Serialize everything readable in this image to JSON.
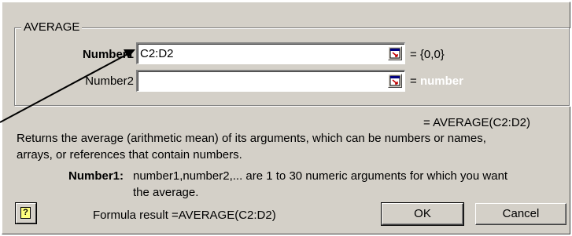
{
  "dialog": {
    "group_title": "AVERAGE",
    "args": [
      {
        "label": "Number1",
        "value": "C2:D2",
        "result": "= {0,0}"
      },
      {
        "label": "Number2",
        "value": "",
        "result_prefix": "= ",
        "result_hint": "number"
      }
    ],
    "formula_preview": "= AVERAGE(C2:D2)",
    "description_line1": "Returns the average (arithmetic mean) of its arguments, which can be numbers or names,",
    "description_line2": "arrays, or references that contain numbers.",
    "arg_help_label": "Number1:",
    "arg_help_text1": "number1,number2,... are 1 to 30 numeric arguments for which you want",
    "arg_help_text2": "the average.",
    "formula_result": "Formula result =AVERAGE(C2:D2)",
    "ok_label": "OK",
    "cancel_label": "Cancel",
    "help_icon": "?"
  },
  "icons": {
    "collapse": "collapse-dialog-icon",
    "help": "help-icon",
    "annotation": "arrow-annotation"
  },
  "colors": {
    "dialog_bg": "#d4d0c8",
    "hint_text": "#ffffff"
  }
}
